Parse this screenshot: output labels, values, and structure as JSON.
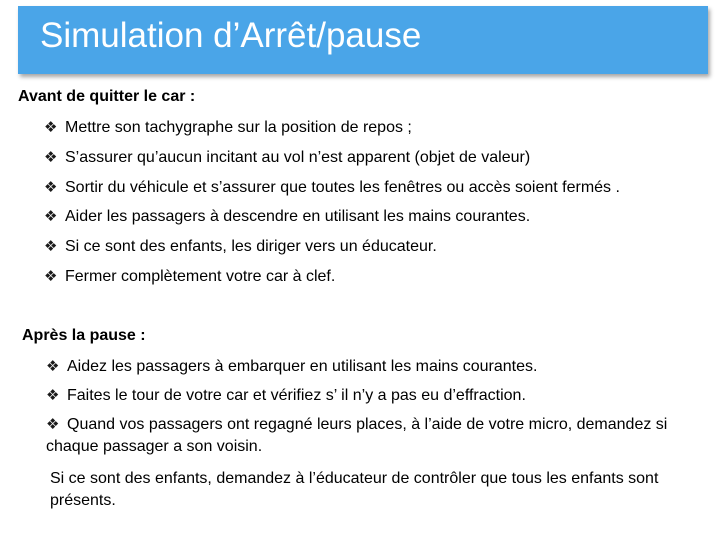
{
  "slide": {
    "title": "Simulation d’Arrêt/pause"
  },
  "before_leaving": {
    "heading": "Avant de quitter le car :",
    "items": [
      "Mettre son tachygraphe sur la position de repos ;",
      "S’assurer qu’aucun incitant au vol n’est apparent (objet de valeur)",
      "Sortir du véhicule et s’assurer que toutes les fenêtres  ou accès soient fermés .",
      "Aider les passagers à descendre en utilisant les mains courantes.",
      "Si ce sont des enfants, les diriger vers un éducateur.",
      "Fermer complètement votre car à clef."
    ]
  },
  "after_break": {
    "heading": "Après la pause :",
    "items": [
      "Aidez les passagers à embarquer en utilisant les mains courantes.",
      "Faites le tour de votre car et vérifiez s’ il n’y a pas eu d’effraction.",
      "Quand vos passagers ont regagné leurs places, à l’aide de votre micro, demandez si chaque passager a son voisin."
    ],
    "note": "Si ce sont des enfants, demandez à l’éducateur de contrôler que tous les enfants sont présents."
  },
  "bullet_icon": "diamond-cluster-icon",
  "colors": {
    "title_bar": "#4aa5e8",
    "title_text": "#ffffff",
    "body_text": "#000000"
  }
}
